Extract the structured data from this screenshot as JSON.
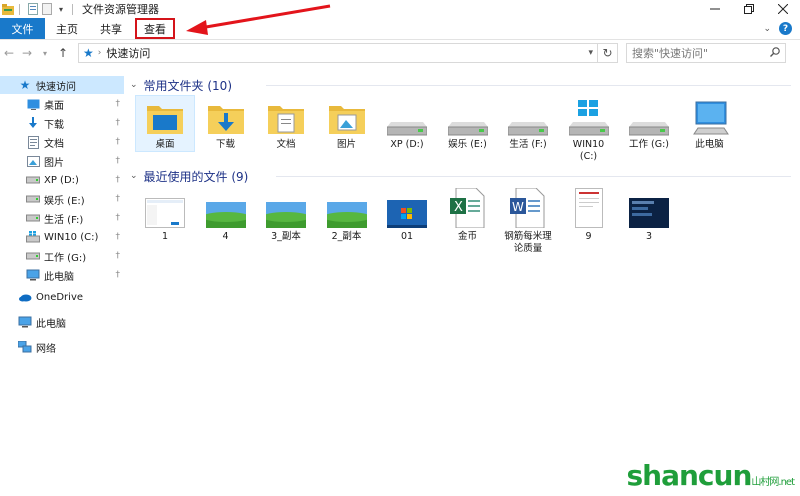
{
  "window": {
    "title": "文件资源管理器"
  },
  "ribbon": {
    "tabs": [
      "文件",
      "主页",
      "共享",
      "查看"
    ]
  },
  "address": {
    "path": "快速访问",
    "search_placeholder": "搜索\"快速访问\""
  },
  "nav": {
    "quick_access": "快速访问",
    "pinned": [
      {
        "label": "桌面",
        "icon": "desktop-icon"
      },
      {
        "label": "下载",
        "icon": "download-icon"
      },
      {
        "label": "文档",
        "icon": "document-icon"
      },
      {
        "label": "图片",
        "icon": "pictures-icon"
      },
      {
        "label": "XP (D:)",
        "icon": "drive-icon"
      },
      {
        "label": "娱乐 (E:)",
        "icon": "drive-icon"
      },
      {
        "label": "生活 (F:)",
        "icon": "drive-icon"
      },
      {
        "label": "WIN10 (C:)",
        "icon": "windows-drive-icon"
      },
      {
        "label": "工作 (G:)",
        "icon": "drive-icon"
      },
      {
        "label": "此电脑",
        "icon": "computer-icon"
      }
    ],
    "onedrive": "OneDrive",
    "this_pc": "此电脑",
    "network": "网络"
  },
  "frequent": {
    "title": "常用文件夹 (10)",
    "items": [
      {
        "label": "桌面",
        "icon": "desktop-folder"
      },
      {
        "label": "下载",
        "icon": "download-folder"
      },
      {
        "label": "文档",
        "icon": "document-folder"
      },
      {
        "label": "图片",
        "icon": "pictures-folder"
      },
      {
        "label": "XP (D:)",
        "icon": "drive"
      },
      {
        "label": "娱乐 (E:)",
        "icon": "drive"
      },
      {
        "label": "生活 (F:)",
        "icon": "drive"
      },
      {
        "label": "WIN10\n(C:)",
        "icon": "windows-drive"
      },
      {
        "label": "工作 (G:)",
        "icon": "drive"
      },
      {
        "label": "此电脑",
        "icon": "computer"
      }
    ]
  },
  "recent": {
    "title": "最近使用的文件 (9)",
    "items": [
      {
        "label": "1",
        "icon": "screenshot-thumb"
      },
      {
        "label": "4",
        "icon": "landscape-thumb"
      },
      {
        "label": "3_副本",
        "icon": "landscape-thumb"
      },
      {
        "label": "2_副本",
        "icon": "landscape-thumb"
      },
      {
        "label": "01",
        "icon": "win7-thumb"
      },
      {
        "label": "金币",
        "icon": "excel-file"
      },
      {
        "label": "钢筋每米理\n论质量",
        "icon": "word-file"
      },
      {
        "label": "9",
        "icon": "doc-thumb"
      },
      {
        "label": "3",
        "icon": "dark-thumb"
      }
    ]
  },
  "watermark": {
    "text": "shancun",
    "sub": "山村网.net"
  },
  "colors": {
    "accent": "#1979ca",
    "highlight": "#d4141a",
    "selected": "#cce8ff",
    "section": "#1e3287"
  }
}
